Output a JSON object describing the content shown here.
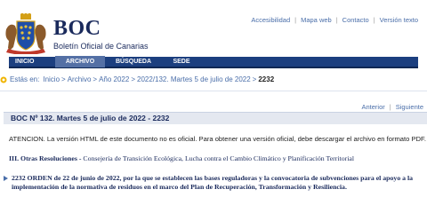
{
  "brand": {
    "title": "BOC",
    "subtitle": "Boletín Oficial de Canarias"
  },
  "top_links": [
    {
      "label": "Accesibilidad"
    },
    {
      "label": "Mapa web"
    },
    {
      "label": "Contacto"
    },
    {
      "label": "Versión texto"
    }
  ],
  "nav": {
    "items": [
      {
        "label": "INICIO"
      },
      {
        "label": "ARCHIVO"
      },
      {
        "label": "BÚSQUEDA"
      },
      {
        "label": "SEDE"
      }
    ],
    "active": "ARCHIVO"
  },
  "breadcrumb": {
    "label": "Estás en:",
    "links": [
      "Inicio",
      "Archivo",
      "Año 2022",
      "2022/132. Martes 5 de julio de 2022"
    ],
    "separator": ">",
    "current": "2232"
  },
  "pager": {
    "prev": "Anterior",
    "next": "Siguiente"
  },
  "boc_heading": "BOC Nº 132. Martes 5 de julio de 2022 - 2232",
  "notice": "ATENCION. La versión HTML de este documento no es oficial. Para obtener una versión oficial, debe descargar el archivo en formato PDF.",
  "section": {
    "prefix": "III. Otras Resoluciones -",
    "text": "Consejería de Transición Ecológica, Lucha contra el Cambio Climático y Planificación Territorial"
  },
  "entry": {
    "text": "2232 ORDEN de 22 de junio de 2022, por la que se establecen las bases reguladoras y la convocatoria de subvenciones para el apoyo a la implementación de la normativa de residuos en el marco del Plan de Recuperación, Transformación y Resiliencia."
  },
  "colors": {
    "nav_bg": "#1c3f7f",
    "nav_active": "#5470a5",
    "link": "#4a6ea9",
    "heading_bg": "#e4e8f0",
    "brand": "#1a2a5c",
    "breadcrumb_icon": "#f0b400"
  },
  "icons": {
    "logo": "canarias-coat-of-arms-icon",
    "breadcrumb": "location-bullet-icon",
    "entry": "triangle-right-icon"
  }
}
